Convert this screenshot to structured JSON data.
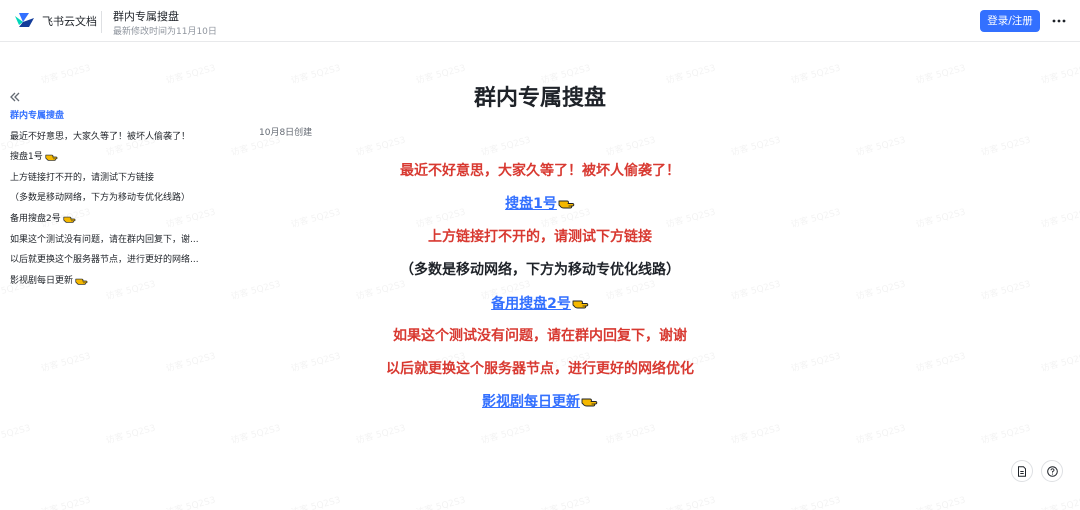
{
  "header": {
    "brand": "飞书云文档",
    "doc_title": "群内专属搜盘",
    "last_modified": "最新修改时间为11月10日",
    "login_label": "登录/注册"
  },
  "watermark": {
    "text": "访客 5Q2S3"
  },
  "toc": {
    "items": [
      {
        "label": "群内专属搜盘",
        "active": true,
        "hand": false
      },
      {
        "label": "最近不好意思，大家久等了！被坏人偷袭了！",
        "hand": false
      },
      {
        "label": "搜盘1号",
        "hand": true
      },
      {
        "label": "上方链接打不开的，请测试下方链接",
        "hand": false
      },
      {
        "label": "（多数是移动网络，下方为移动专优化线路）",
        "hand": false
      },
      {
        "label": "备用搜盘2号",
        "hand": true
      },
      {
        "label": "如果这个测试没有问题，请在群内回复下，谢...",
        "hand": false
      },
      {
        "label": "以后就更换这个服务器节点，进行更好的网络...",
        "hand": false
      },
      {
        "label": "影视剧每日更新",
        "hand": true
      }
    ]
  },
  "doc": {
    "created": "10月8日创建",
    "title": "群内专属搜盘",
    "lines": [
      {
        "text": "最近不好意思，大家久等了！被坏人偷袭了！",
        "style": "red",
        "hand": false
      },
      {
        "text": "搜盘1号",
        "style": "link",
        "hand": true
      },
      {
        "text": "上方链接打不开的，请测试下方链接",
        "style": "red",
        "hand": false
      },
      {
        "text": "（多数是移动网络，下方为移动专优化线路）",
        "style": "dark",
        "hand": false
      },
      {
        "text": "备用搜盘2号",
        "style": "link",
        "hand": true
      },
      {
        "text": "如果这个测试没有问题，请在群内回复下，谢谢",
        "style": "red",
        "hand": false
      },
      {
        "text": "以后就更换这个服务器节点，进行更好的网络优化",
        "style": "red",
        "hand": false
      },
      {
        "text": "影视剧每日更新",
        "style": "link",
        "hand": true
      }
    ]
  },
  "icons": {
    "logo": "feishu-logo-icon",
    "more": "more-horizontal-icon",
    "collapse": "double-chevron-left-icon",
    "pointing_hand": "pointing-hand-icon",
    "document": "document-icon",
    "help": "question-circle-icon"
  },
  "colors": {
    "accent": "#3370ff",
    "red_text": "#d83931",
    "text": "#1f2329",
    "muted": "#8f959e"
  }
}
